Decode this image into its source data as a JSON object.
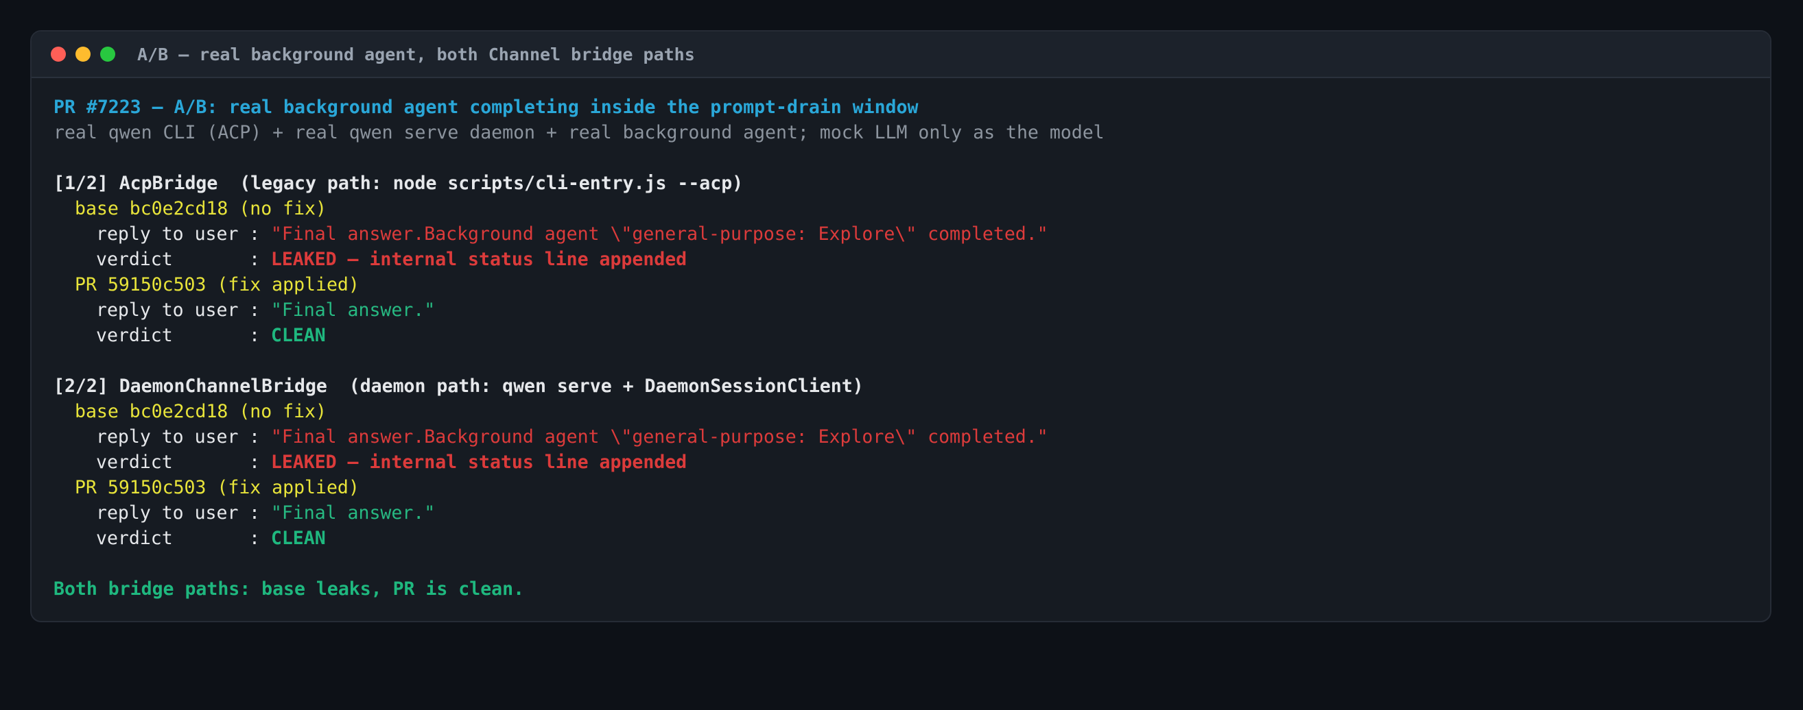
{
  "window": {
    "title": "A/B — real background agent, both Channel bridge paths",
    "controls": [
      "close",
      "minimize",
      "maximize"
    ]
  },
  "header": {
    "headline": "PR #7223 — A/B: real background agent completing inside the prompt-drain window",
    "subline": "real qwen CLI (ACP) + real qwen serve daemon + real background agent; mock LLM only as the model"
  },
  "labels": {
    "reply_key": "reply to user",
    "verdict_key": "verdict",
    "separator": " : "
  },
  "sections": [
    {
      "heading": "[1/2] AcpBridge  (legacy path: node scripts/cli-entry.js --acp)",
      "base": {
        "label": "base bc0e2cd18 (no fix)",
        "reply": "\"Final answer.Background agent \\\"general-purpose: Explore\\\" completed.\"",
        "verdict": "LEAKED — internal status line appended"
      },
      "pr": {
        "label": "PR 59150c503 (fix applied)",
        "reply": "\"Final answer.\"",
        "verdict": "CLEAN"
      }
    },
    {
      "heading": "[2/2] DaemonChannelBridge  (daemon path: qwen serve + DaemonSessionClient)",
      "base": {
        "label": "base bc0e2cd18 (no fix)",
        "reply": "\"Final answer.Background agent \\\"general-purpose: Explore\\\" completed.\"",
        "verdict": "LEAKED — internal status line appended"
      },
      "pr": {
        "label": "PR 59150c503 (fix applied)",
        "reply": "\"Final answer.\"",
        "verdict": "CLEAN"
      }
    }
  ],
  "summary": "Both bridge paths: base leaks, PR is clean.",
  "colors": {
    "background": "#0d1117",
    "window": "#161b22",
    "cyan": "#2aa7d8",
    "yellow": "#e8e43a",
    "red": "#dc3b3b",
    "green": "#1fb87f"
  }
}
